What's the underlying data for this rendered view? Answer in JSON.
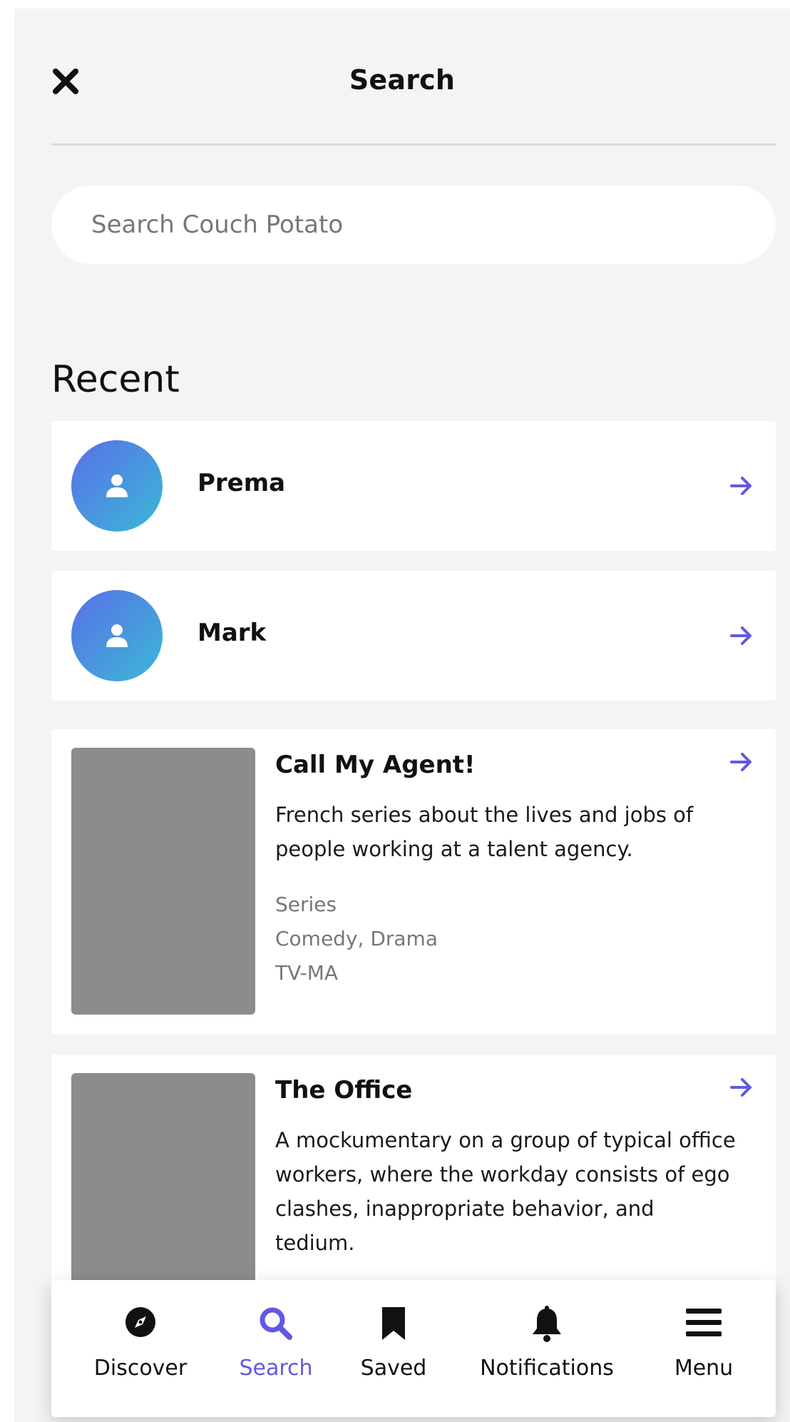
{
  "header": {
    "title": "Search",
    "close_icon": "close-icon"
  },
  "search": {
    "placeholder": "Search Couch Potato",
    "value": ""
  },
  "recent": {
    "title": "Recent",
    "people": [
      {
        "name": "Prema",
        "icon": "user-icon"
      },
      {
        "name": "Mark",
        "icon": "user-icon"
      }
    ],
    "shows": [
      {
        "title": "Call My Agent!",
        "description": "French series about the lives and jobs of people working at a talent agency.",
        "type": "Series",
        "genres": "Comedy, Drama",
        "rating": "TV-MA"
      },
      {
        "title": "The Office",
        "description": "A mockumentary on a group of typical office workers, where the workday consists of ego clashes, inappropriate behavior, and tedium."
      }
    ]
  },
  "tabbar": {
    "tabs": [
      {
        "label": "Discover",
        "icon": "compass-icon"
      },
      {
        "label": "Search",
        "icon": "search-icon",
        "active": true
      },
      {
        "label": "Saved",
        "icon": "bookmark-icon"
      },
      {
        "label": "Notifications",
        "icon": "bell-icon"
      },
      {
        "label": "Menu",
        "icon": "menu-icon"
      }
    ]
  },
  "colors": {
    "accent": "#6259e0",
    "background": "#f4f4f4",
    "avatar_gradient": [
      "#5a6fe8",
      "#3ab9d6"
    ],
    "poster_placeholder": "#8c8c8c"
  }
}
